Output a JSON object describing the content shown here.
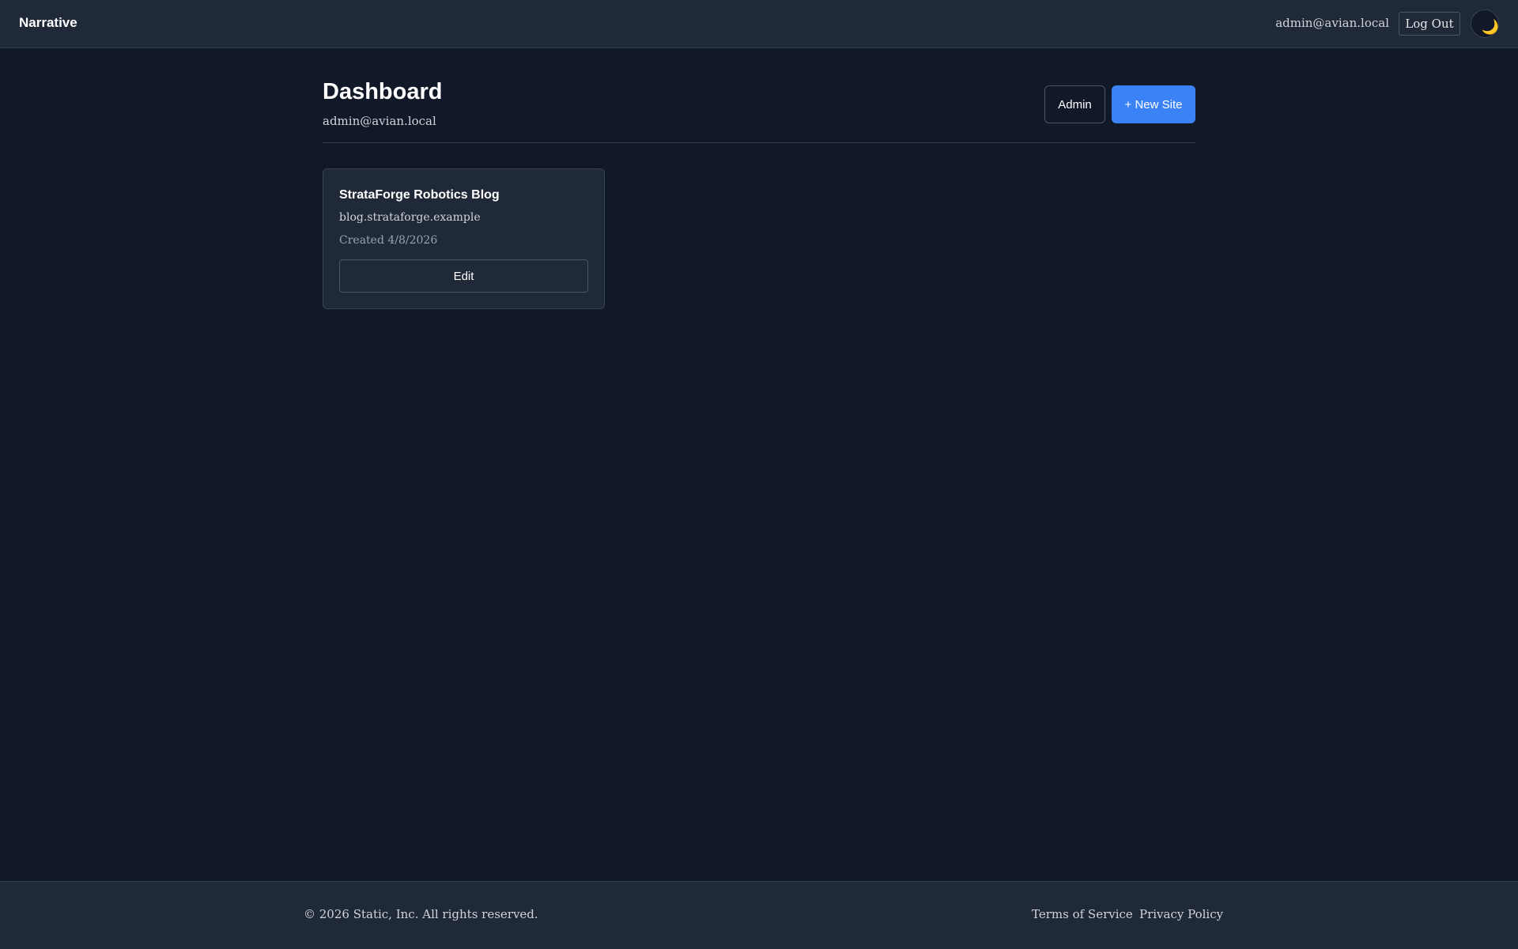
{
  "header": {
    "brand": "Narrative",
    "user_email": "admin@avian.local",
    "logout_label": "Log Out",
    "theme_icon": "moon-icon",
    "theme_glyph": "🌙"
  },
  "main": {
    "title": "Dashboard",
    "subtitle": "admin@avian.local",
    "admin_label": "Admin",
    "new_site_label": "+ New Site",
    "sites": [
      {
        "name": "StrataForge Robotics Blog",
        "domain": "blog.strataforge.example",
        "created": "Created 4/8/2026",
        "edit_label": "Edit"
      }
    ]
  },
  "footer": {
    "copyright": "© 2026 Static, Inc. All rights reserved.",
    "terms_label": "Terms of Service",
    "privacy_label": "Privacy Policy"
  },
  "colors": {
    "background": "#111827",
    "surface": "#1f2937",
    "accent": "#3b82f6",
    "border": "#374151"
  }
}
